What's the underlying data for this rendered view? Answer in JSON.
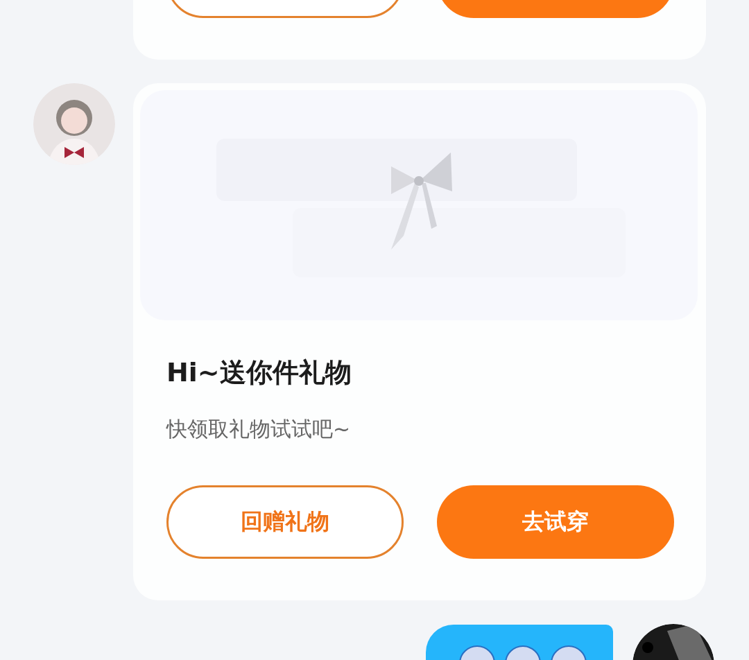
{
  "messages": [
    {
      "kind": "received_gift_card",
      "buttons": [
        {
          "kind": "outline"
        },
        {
          "kind": "filled"
        }
      ]
    },
    {
      "kind": "received_gift_card",
      "banner": {
        "kind": "picture"
      },
      "title": "Hi~送你件礼物",
      "subtitle": "快领取礼物试试吧~",
      "buttons": [
        {
          "kind": "outline",
          "label": "回赠礼物"
        },
        {
          "kind": "filled",
          "label": "去试穿"
        }
      ]
    },
    {
      "kind": "sent_emoji_bubble",
      "emojis": [
        {
          "kind": "round_face"
        },
        {
          "kind": "round_face"
        },
        {
          "kind": "round_face"
        }
      ]
    }
  ]
}
